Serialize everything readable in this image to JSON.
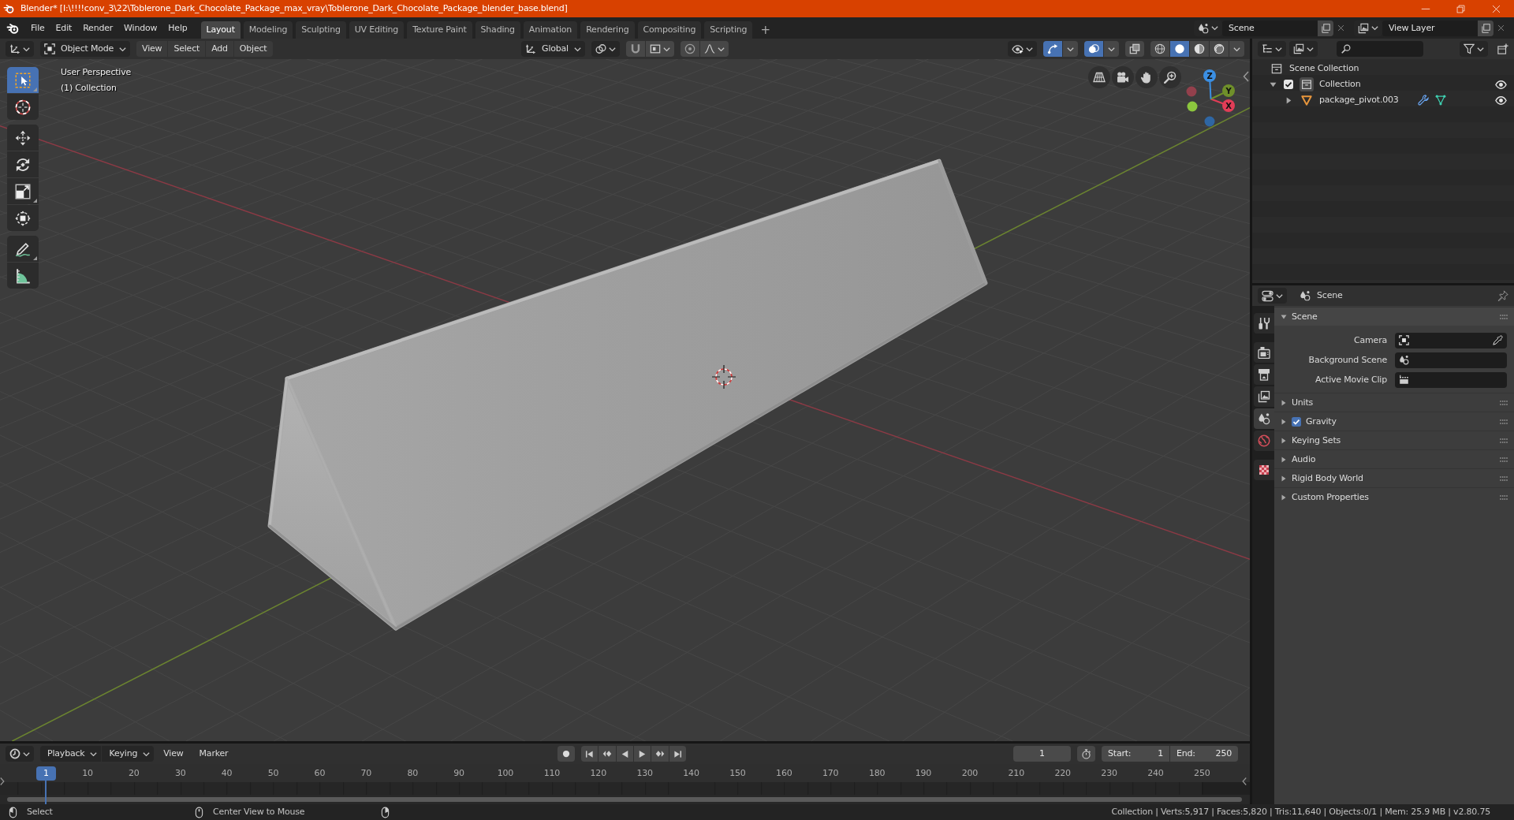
{
  "window": {
    "title": "Blender* [I:\\!!!!conv_3\\22\\Toblerone_Dark_Chocolate_Package_max_vray\\Toblerone_Dark_Chocolate_Package_blender_base.blend]"
  },
  "top_bar": {
    "menus": [
      "File",
      "Edit",
      "Render",
      "Window",
      "Help"
    ],
    "workspaces": [
      {
        "label": "Layout",
        "selected": true
      },
      {
        "label": "Modeling",
        "selected": false
      },
      {
        "label": "Sculpting",
        "selected": false
      },
      {
        "label": "UV Editing",
        "selected": false
      },
      {
        "label": "Texture Paint",
        "selected": false
      },
      {
        "label": "Shading",
        "selected": false
      },
      {
        "label": "Animation",
        "selected": false
      },
      {
        "label": "Rendering",
        "selected": false
      },
      {
        "label": "Compositing",
        "selected": false
      },
      {
        "label": "Scripting",
        "selected": false
      }
    ],
    "add_workspace": "+",
    "scene": "Scene",
    "view_layer": "View Layer"
  },
  "viewport": {
    "mode": "Object Mode",
    "menus": [
      "View",
      "Select",
      "Add",
      "Object"
    ],
    "orientation": "Global",
    "snapping": {
      "on": false
    },
    "proportional_editing": {
      "on": false
    },
    "gizmos": {
      "on": true
    },
    "overlays": {
      "on": true
    },
    "xray": {
      "on": false
    },
    "shading": [
      {
        "kind": "wireframe",
        "selected": false
      },
      {
        "kind": "solid",
        "selected": true
      },
      {
        "kind": "material",
        "selected": false
      },
      {
        "kind": "rendered",
        "selected": false
      }
    ],
    "overlay_text": [
      "User Perspective",
      "(1) Collection"
    ],
    "tool_groups": [
      {
        "tools": [
          {
            "kind": "select_box",
            "selected": true,
            "more": true
          },
          {
            "kind": "cursor",
            "selected": false
          }
        ]
      },
      {
        "tools": [
          {
            "kind": "move",
            "selected": false
          },
          {
            "kind": "rotate",
            "selected": false
          },
          {
            "kind": "scale",
            "selected": false,
            "more": true
          },
          {
            "kind": "transform",
            "selected": false
          }
        ]
      },
      {
        "tools": [
          {
            "kind": "annotate",
            "selected": false,
            "more": true
          },
          {
            "kind": "measure",
            "selected": false
          }
        ]
      }
    ],
    "navigation_gizmo": [
      {
        "kind": "x",
        "label": "X"
      },
      {
        "kind": "y",
        "label": "Y"
      },
      {
        "kind": "z",
        "label": "Z"
      }
    ]
  },
  "outliner": {
    "items": [
      {
        "kind": "scene_collection",
        "label": "Scene Collection",
        "active": false,
        "children": [
          {
            "kind": "collection",
            "label": "Collection",
            "active": true,
            "expanded": true,
            "checked": true,
            "visible": true,
            "children": [
              {
                "kind": "mesh_object",
                "label": "package_pivot.003",
                "active": false,
                "expanded": false,
                "visible": true,
                "sub_items": [
                  {
                    "kind": "modifiers"
                  },
                  {
                    "kind": "mesh"
                  }
                ]
              }
            ]
          }
        ]
      }
    ]
  },
  "properties": {
    "context": "Scene",
    "tab_groups": [
      {
        "tabs": [
          {
            "kind": "tool",
            "selected": false
          }
        ]
      },
      {
        "tabs": [
          {
            "kind": "render",
            "selected": false
          },
          {
            "kind": "output",
            "selected": false
          },
          {
            "kind": "view_layer",
            "selected": false
          },
          {
            "kind": "scene",
            "selected": true
          },
          {
            "kind": "world",
            "selected": false
          }
        ]
      },
      {
        "tabs": [
          {
            "kind": "texture",
            "selected": false
          }
        ]
      }
    ],
    "panels": [
      {
        "label": "Scene",
        "expanded": true,
        "fields": [
          {
            "label": "Camera",
            "kind": "object",
            "eyedropper": true
          },
          {
            "label": "Background Scene",
            "kind": "scene"
          },
          {
            "label": "Active Movie Clip",
            "kind": "movie_clip"
          }
        ]
      },
      {
        "label": "Units",
        "expanded": false
      },
      {
        "label": "Gravity",
        "expanded": false,
        "checked": true
      },
      {
        "label": "Keying Sets",
        "expanded": false
      },
      {
        "label": "Audio",
        "expanded": false
      },
      {
        "label": "Rigid Body World",
        "expanded": false
      },
      {
        "label": "Custom Properties",
        "expanded": false
      }
    ]
  },
  "timeline": {
    "menus": [
      {
        "label": "Playback",
        "kind": "dropdown"
      },
      {
        "label": "Keying",
        "kind": "dropdown"
      },
      {
        "label": "View",
        "kind": "menu"
      },
      {
        "label": "Marker",
        "kind": "menu"
      }
    ],
    "current_frame": "1",
    "start": {
      "label": "Start:",
      "value": "1"
    },
    "end": {
      "label": "End:",
      "value": "250"
    },
    "playhead": "1",
    "ruler_labels": [
      "10",
      "20",
      "30",
      "40",
      "50",
      "60",
      "70",
      "80",
      "90",
      "100",
      "110",
      "120",
      "130",
      "140",
      "150",
      "160",
      "170",
      "180",
      "190",
      "200",
      "210",
      "220",
      "230",
      "240",
      "250"
    ]
  },
  "status_bar": {
    "hints": [
      {
        "kind": "left_click",
        "label": "Select"
      },
      {
        "kind": "middle_click",
        "label": "Center View to Mouse"
      },
      {
        "kind": "right_click"
      }
    ],
    "stats": "Collection | Verts:5,917 | Faces:5,820 | Tris:11,640 | Objects:0/1 | Mem: 25.9 MB | v2.80.75"
  }
}
